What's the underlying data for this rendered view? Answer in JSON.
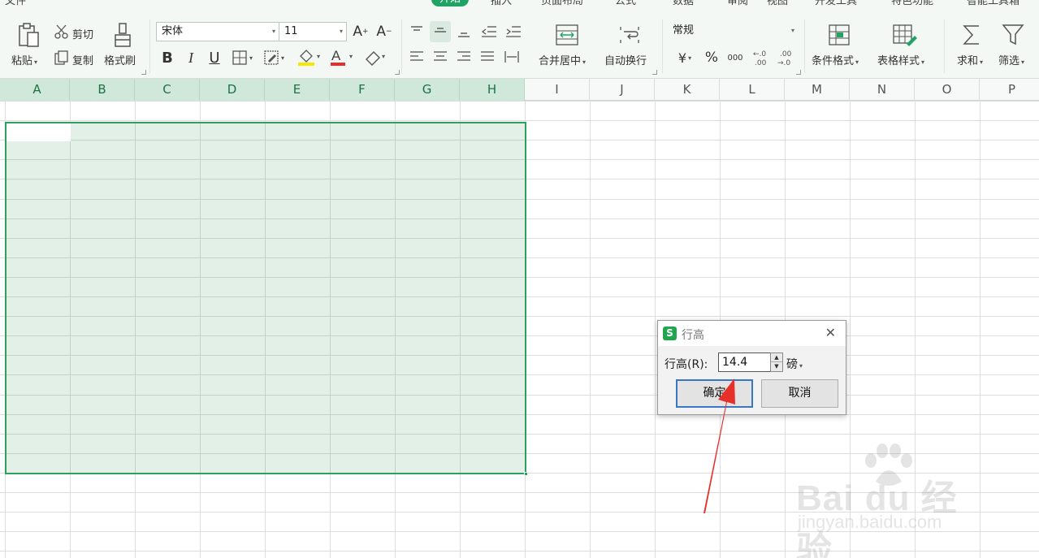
{
  "ribbon": {
    "tabs": [
      "文件",
      "开始",
      "插入",
      "页面布局",
      "公式",
      "数据",
      "审阅",
      "视图",
      "开发工具",
      "特色功能",
      "智能工具箱"
    ],
    "active_tab": "开始",
    "clipboard": {
      "paste": "粘贴",
      "cut": "剪切",
      "copy": "复制",
      "format_painter": "格式刷"
    },
    "font": {
      "name": "宋体",
      "size": "11"
    },
    "alignment": {
      "merge_center": "合并居中",
      "wrap_text": "自动换行"
    },
    "number": {
      "format": "常规",
      "currency": "¥",
      "percent": "%",
      "thousands": "000",
      "inc_decimal": "←.0\n.00",
      "dec_decimal": ".00\n→.0"
    },
    "editing": {
      "conditional_format": "条件格式",
      "table_style": "表格样式",
      "sum": "求和",
      "filter": "筛选"
    }
  },
  "sheet": {
    "columns": [
      "A",
      "B",
      "C",
      "D",
      "E",
      "F",
      "G",
      "H",
      "I",
      "J",
      "K",
      "L",
      "M",
      "N",
      "O",
      "P"
    ],
    "selected_columns": [
      "A",
      "B",
      "C",
      "D",
      "E",
      "F",
      "G",
      "H"
    ],
    "selection_color": "#2e9f5e"
  },
  "dialog": {
    "title": "行高",
    "label": "行高(R):",
    "value": "14.4",
    "unit": "磅",
    "ok": "确定",
    "cancel": "取消"
  },
  "watermark": {
    "brand": "Bai du 经验",
    "url": "jingyan.baidu.com"
  },
  "colors": {
    "accent": "#21a366",
    "ribbon_bg": "#f3f8f4",
    "arrow": "#e8302a"
  }
}
